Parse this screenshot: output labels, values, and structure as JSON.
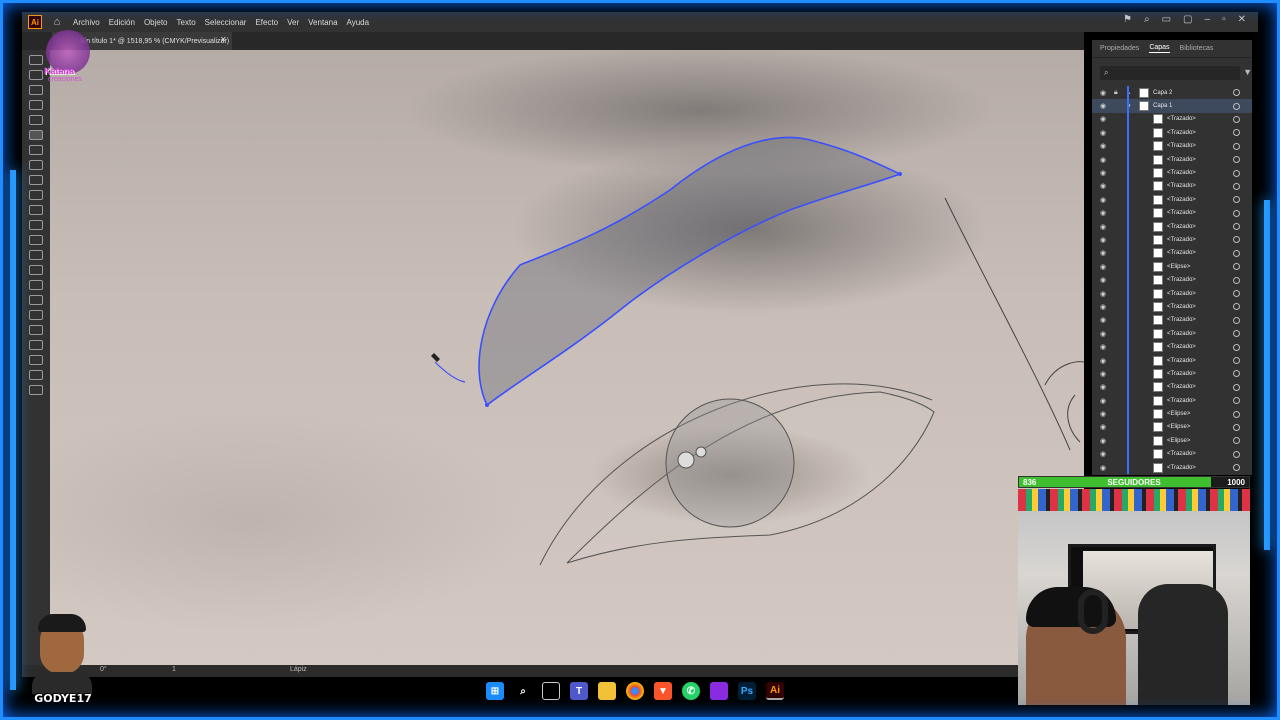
{
  "app": {
    "logo": "Ai",
    "menu": [
      "Archivo",
      "Edición",
      "Objeto",
      "Texto",
      "Seleccionar",
      "Efecto",
      "Ver",
      "Ventana",
      "Ayuda"
    ]
  },
  "document": {
    "tab_title": "Sin título 1* @ 1518,95 % (CMYK/Previsualizar)"
  },
  "status": {
    "rotation": "0°",
    "artboard": "1",
    "tool": "Lápiz"
  },
  "panel": {
    "tabs": [
      "Propiedades",
      "Capas",
      "Bibliotecas"
    ],
    "active_tab": "Capas",
    "layers": [
      {
        "name": "Capa 2",
        "type": "layer"
      },
      {
        "name": "Capa 1",
        "type": "layer",
        "selected": true
      },
      {
        "name": "<Trazado>"
      },
      {
        "name": "<Trazado>"
      },
      {
        "name": "<Trazado>"
      },
      {
        "name": "<Trazado>"
      },
      {
        "name": "<Trazado>"
      },
      {
        "name": "<Trazado>"
      },
      {
        "name": "<Trazado>"
      },
      {
        "name": "<Trazado>"
      },
      {
        "name": "<Trazado>"
      },
      {
        "name": "<Trazado>"
      },
      {
        "name": "<Trazado>"
      },
      {
        "name": "<Elipse>"
      },
      {
        "name": "<Trazado>"
      },
      {
        "name": "<Trazado>"
      },
      {
        "name": "<Trazado>"
      },
      {
        "name": "<Trazado>"
      },
      {
        "name": "<Trazado>"
      },
      {
        "name": "<Trazado>"
      },
      {
        "name": "<Trazado>"
      },
      {
        "name": "<Trazado>"
      },
      {
        "name": "<Trazado>"
      },
      {
        "name": "<Trazado>"
      },
      {
        "name": "<Elipse>"
      },
      {
        "name": "<Elipse>"
      },
      {
        "name": "<Elipse>"
      },
      {
        "name": "<Trazado>"
      },
      {
        "name": "<Trazado>"
      }
    ]
  },
  "followers": {
    "current": "836",
    "label": "SEGUIDORES",
    "goal": "1000",
    "progress": 0.836
  },
  "stream": {
    "logo_text": "Katana",
    "logo_sub": "creaciones",
    "streamer_name": "GODYE17"
  },
  "taskbar": {
    "icons": [
      "windows-start",
      "search",
      "task-view",
      "teams",
      "file-explorer",
      "chrome",
      "brave",
      "whatsapp",
      "winrar",
      "photoshop",
      "illustrator"
    ],
    "labels": {
      "photoshop": "Ps",
      "illustrator": "Ai"
    }
  },
  "colors": {
    "accent_glow": "#1f8cff",
    "path_selection": "#3a4fff",
    "follower_bar": "#3fbf2f"
  }
}
